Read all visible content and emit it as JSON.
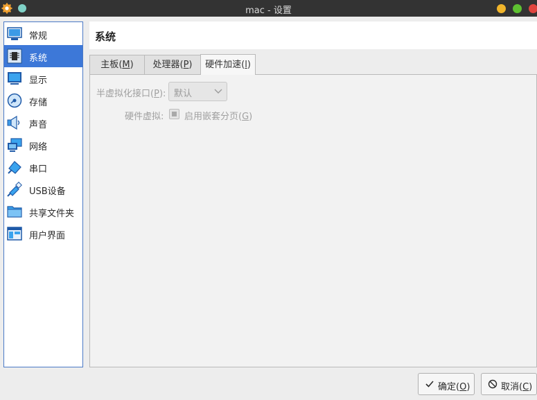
{
  "window": {
    "title": "mac - 设置",
    "controls": {
      "minimize": "#f1b52b",
      "maximize": "#5ec131",
      "close": "#e0443e"
    }
  },
  "sidebar": {
    "items": [
      {
        "label": "常规",
        "icon": "general-icon",
        "selected": false
      },
      {
        "label": "系统",
        "icon": "system-chip-icon",
        "selected": true
      },
      {
        "label": "显示",
        "icon": "display-monitor-icon",
        "selected": false
      },
      {
        "label": "存储",
        "icon": "storage-disk-icon",
        "selected": false
      },
      {
        "label": "声音",
        "icon": "speaker-icon",
        "selected": false
      },
      {
        "label": "网络",
        "icon": "network-icon",
        "selected": false
      },
      {
        "label": "串口",
        "icon": "serial-port-icon",
        "selected": false
      },
      {
        "label": "USB设备",
        "icon": "usb-icon",
        "selected": false
      },
      {
        "label": "共享文件夹",
        "icon": "shared-folder-icon",
        "selected": false
      },
      {
        "label": "用户界面",
        "icon": "user-interface-icon",
        "selected": false
      }
    ]
  },
  "header": {
    "title": "系统"
  },
  "tabs": [
    {
      "label": "主板",
      "mnemonic": "M",
      "active": false
    },
    {
      "label": "处理器",
      "mnemonic": "P",
      "active": false
    },
    {
      "label": "硬件加速",
      "mnemonic": "l",
      "active": true
    }
  ],
  "acceleration": {
    "paravirt_label": "半虚拟化接口",
    "paravirt_mnemonic": "P",
    "paravirt_value": "默认",
    "hwvirt_label": "硬件虚拟:",
    "nested_paging_label": "启用嵌套分页",
    "nested_paging_mnemonic": "G",
    "nested_paging_checked": true
  },
  "buttons": {
    "ok": {
      "label": "确定",
      "mnemonic": "O"
    },
    "cancel": {
      "label": "取消",
      "mnemonic": "C"
    }
  },
  "colors": {
    "accent": "#3d78d8",
    "titlebar": "#333333"
  }
}
